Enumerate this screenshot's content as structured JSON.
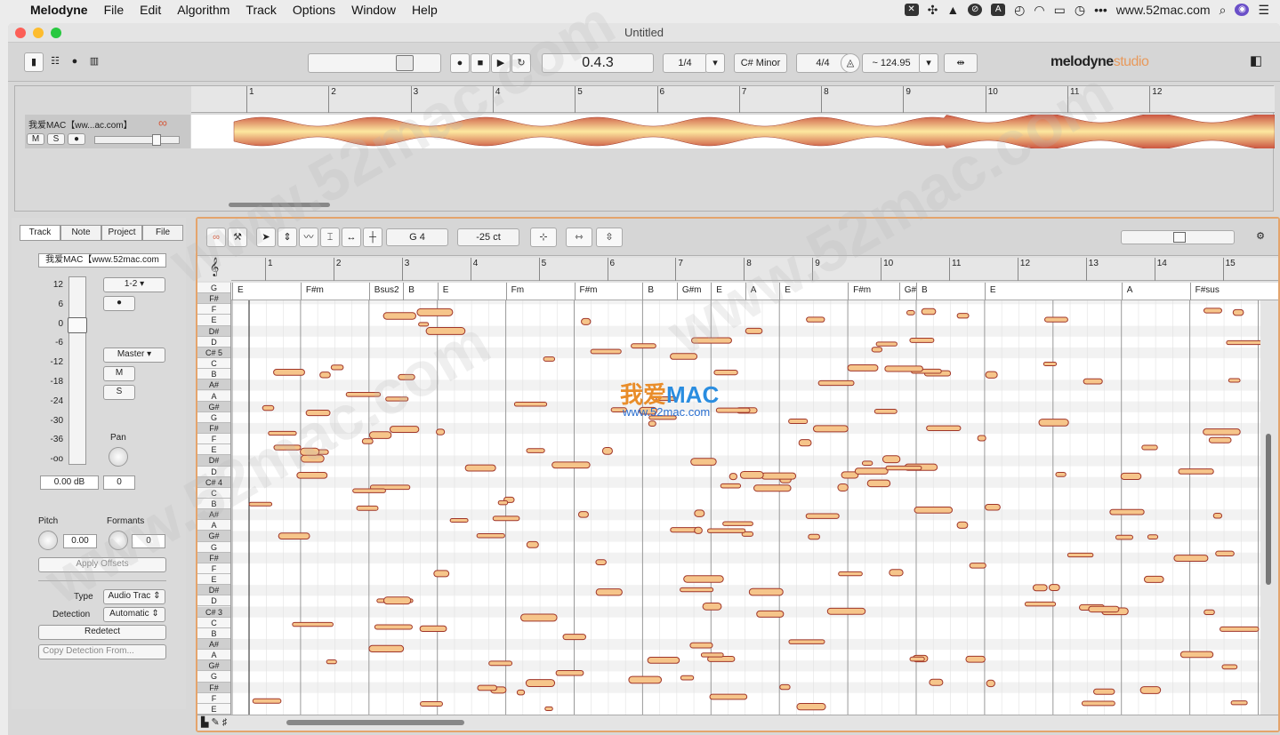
{
  "menubar": {
    "app": "Melodyne",
    "items": [
      "File",
      "Edit",
      "Algorithm",
      "Track",
      "Options",
      "Window",
      "Help"
    ],
    "site": "www.52mac.com"
  },
  "window": {
    "title": "Untitled"
  },
  "toolbar": {
    "position": "0.4.3",
    "quantize": "1/4",
    "key": "C# Minor",
    "meter": "4/4",
    "tempo": "~ 124.95",
    "logo_a": "melodyne",
    "logo_b": "studio"
  },
  "arrange": {
    "bars": [
      "1",
      "2",
      "3",
      "4",
      "5",
      "6",
      "7",
      "8",
      "9",
      "10",
      "11",
      "12"
    ],
    "track_name": "我爱MAC【ww...ac.com】",
    "mute": "M",
    "solo": "S"
  },
  "inspector": {
    "tabs": [
      "Track",
      "Note",
      "Project",
      "File"
    ],
    "track_name": "我爱MAC【www.52mac.com",
    "fader_scale": [
      "12",
      "6",
      "0",
      "-6",
      "-12",
      "-18",
      "-24",
      "-30",
      "-36",
      "-oo"
    ],
    "output": "1-2",
    "bus": "Master",
    "mute": "M",
    "solo": "S",
    "pan_label": "Pan",
    "gain_value": "0.00 dB",
    "pan_value": "0",
    "pitch_label": "Pitch",
    "formants_label": "Formants",
    "pitch_value": "0.00",
    "formants_value": "0",
    "apply_offsets": "Apply Offsets",
    "type_label": "Type",
    "type_value": "Audio Trac",
    "detection_label": "Detection",
    "detection_value": "Automatic",
    "redetect": "Redetect",
    "copy_detection": "Copy Detection From..."
  },
  "editor": {
    "note_name": "G 4",
    "cents": "-25 ct",
    "bars": [
      "1",
      "2",
      "3",
      "4",
      "5",
      "6",
      "7",
      "8",
      "9",
      "10",
      "11",
      "12",
      "13",
      "14",
      "15"
    ],
    "chords": [
      {
        "label": "E",
        "bar": 0.0
      },
      {
        "label": "F#m",
        "bar": 1.0
      },
      {
        "label": "Bsus2",
        "bar": 2.0
      },
      {
        "label": "B",
        "bar": 2.5
      },
      {
        "label": "E",
        "bar": 3.0
      },
      {
        "label": "Fm",
        "bar": 4.0
      },
      {
        "label": "F#m",
        "bar": 5.0
      },
      {
        "label": "B",
        "bar": 6.0
      },
      {
        "label": "G#m",
        "bar": 6.5
      },
      {
        "label": "E",
        "bar": 7.0
      },
      {
        "label": "A",
        "bar": 7.5
      },
      {
        "label": "E",
        "bar": 8.0
      },
      {
        "label": "F#m",
        "bar": 9.0
      },
      {
        "label": "G#",
        "bar": 9.75
      },
      {
        "label": "B",
        "bar": 10.0
      },
      {
        "label": "E",
        "bar": 11.0
      },
      {
        "label": "A",
        "bar": 13.0
      },
      {
        "label": "F#sus",
        "bar": 14.0
      }
    ],
    "keys": [
      "G",
      "F#",
      "F",
      "E",
      "D#",
      "D",
      "C# 5",
      "C",
      "B",
      "A#",
      "A",
      "G#",
      "G",
      "F#",
      "F",
      "E",
      "D#",
      "D",
      "C# 4",
      "C",
      "B",
      "A#",
      "A",
      "G#",
      "G",
      "F#",
      "F",
      "E",
      "D#",
      "D",
      "C# 3",
      "C",
      "B",
      "A#",
      "A",
      "G#",
      "G",
      "F#",
      "F",
      "E"
    ]
  },
  "watermark": {
    "brand_a": "我爱",
    "brand_b": "MAC",
    "url": "www.52mac.com"
  }
}
